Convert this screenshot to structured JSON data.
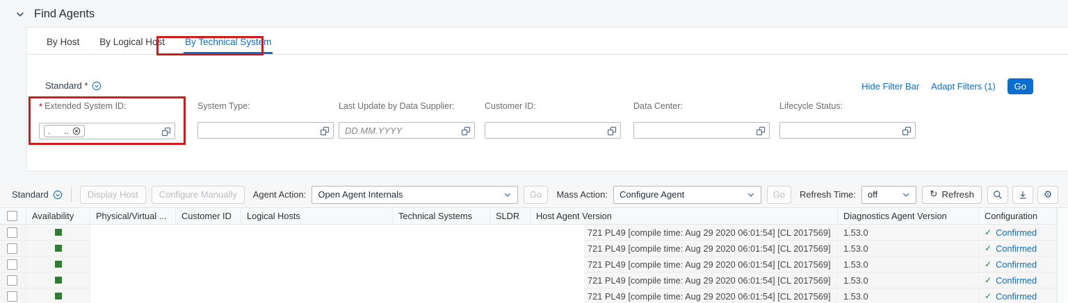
{
  "colors": {
    "accent_blue": "#0a6ed1",
    "positive_green": "#107e3e",
    "availability_green": "#2f7d33",
    "annotation_red": "#cf1d1d"
  },
  "header": {
    "title": "Find Agents"
  },
  "tabs": [
    {
      "label": "By Host",
      "selected": false
    },
    {
      "label": "By Logical Host",
      "selected": false
    },
    {
      "label": "By Technical System",
      "selected": true
    }
  ],
  "filter_bar": {
    "variant": "Standard *",
    "hide_filter_bar_label": "Hide Filter Bar",
    "adapt_filters_label": "Adapt Filters (1)",
    "go_label": "Go",
    "fields": [
      {
        "label": "Extended System ID:",
        "required_mark": "*",
        "token_text": ".      ..",
        "type": "token"
      },
      {
        "label": "System Type:",
        "value": ""
      },
      {
        "label": "Last Update by Data Supplier:",
        "placeholder": "DD.MM.YYYY",
        "value": ""
      },
      {
        "label": "Customer ID:",
        "value": ""
      },
      {
        "label": "Data Center:",
        "value": ""
      },
      {
        "label": "Lifecycle Status:",
        "value": ""
      }
    ]
  },
  "toolbar": {
    "variant": "Standard",
    "display_host_label": "Display Host",
    "configure_manually_label": "Configure Manually",
    "agent_action_label": "Agent Action:",
    "agent_action_value": "Open Agent Internals",
    "go1_label": "Go",
    "mass_action_label": "Mass Action:",
    "mass_action_value": "Configure Agent",
    "go2_label": "Go",
    "refresh_time_label": "Refresh Time:",
    "refresh_time_value": "off",
    "refresh_label": "Refresh"
  },
  "icons": {
    "refresh_glyph": "↻",
    "gear_glyph": "⚙",
    "check_glyph": "✓"
  },
  "table": {
    "columns": [
      "Availability",
      "Physical/Virtual ...",
      "Customer ID",
      "Logical Hosts",
      "Technical Systems",
      "SLDR",
      "Host Agent Version",
      "Diagnostics Agent Version",
      "Configuration"
    ],
    "rows": [
      {
        "availability": "green",
        "host_agent_version": "721 PL49 [compile time: Aug 29 2020 06:01:54] [CL 2017569]",
        "diagnostics_agent_version": "1.53.0",
        "configuration": "Confirmed"
      },
      {
        "availability": "green",
        "host_agent_version": "721 PL49 [compile time: Aug 29 2020 06:01:54] [CL 2017569]",
        "diagnostics_agent_version": "1.53.0",
        "configuration": "Confirmed"
      },
      {
        "availability": "green",
        "host_agent_version": "721 PL49 [compile time: Aug 29 2020 06:01:54] [CL 2017569]",
        "diagnostics_agent_version": "1.53.0",
        "configuration": "Confirmed"
      },
      {
        "availability": "green",
        "host_agent_version": "721 PL49 [compile time: Aug 29 2020 06:01:54] [CL 2017569]",
        "diagnostics_agent_version": "1.53.0",
        "configuration": "Confirmed"
      },
      {
        "availability": "green",
        "host_agent_version": "721 PL49 [compile time: Aug 29 2020 06:01:54] [CL 2017569]",
        "diagnostics_agent_version": "1.53.0",
        "configuration": "Confirmed"
      }
    ]
  }
}
